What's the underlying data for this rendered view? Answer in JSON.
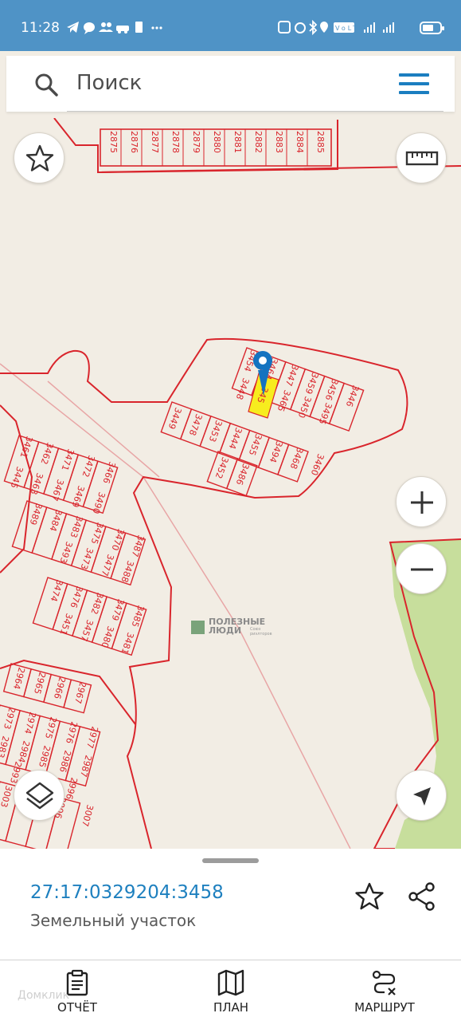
{
  "status_bar": {
    "time": "11:28",
    "left_icons": [
      "telegram-icon",
      "chat-icon",
      "people-icon",
      "car-icon",
      "sim-icon",
      "more-icon"
    ],
    "right_icons": [
      "nfc-icon",
      "alarm-icon",
      "bluetooth-icon",
      "location-icon",
      "volte-icon",
      "signal-icon",
      "wifi-signal-icon",
      "battery-icon"
    ],
    "network_label": "VoLTE"
  },
  "search": {
    "placeholder": "Поиск"
  },
  "map": {
    "parcels_top": [
      "2875",
      "2876",
      "2877",
      "2878",
      "2879",
      "2880",
      "2881",
      "2882",
      "2883",
      "2884",
      "2885"
    ],
    "parcels_cluster_north": [
      "3454",
      "3464",
      "3448",
      "3447",
      "3459",
      "3456",
      "3446",
      "3465",
      "3450",
      "3495",
      "3449",
      "3478",
      "3453",
      "3444",
      "3455",
      "3494",
      "3468",
      "3460",
      "3452",
      "3486"
    ],
    "selected_parcel": "345",
    "parcels_west_a": [
      "3461",
      "3445",
      "3462",
      "3463",
      "3471",
      "3467",
      "3472",
      "3469",
      "3466",
      "3490"
    ],
    "parcels_west_b": [
      "3489",
      "3484",
      "3483",
      "3493",
      "3475",
      "3473",
      "3470",
      "3477",
      "3487",
      "3488"
    ],
    "parcels_west_c": [
      "3474",
      "3476",
      "3451",
      "3482",
      "3457",
      "3479",
      "3480",
      "3485",
      "3481"
    ],
    "parcels_south_a": [
      "2964",
      "2965",
      "2966",
      "2967"
    ],
    "parcels_south_b": [
      "2973",
      "2983",
      "2974",
      "2984",
      "2975",
      "2985",
      "2976",
      "2986",
      "2977",
      "2987"
    ],
    "parcels_south_c": [
      "3003",
      "3005",
      "3006",
      "2996",
      "3007",
      "2993"
    ],
    "watermark_title": "ПОЛЕЗНЫЕ ЛЮДИ",
    "watermark_sub": "Союз риэлторов",
    "colors": {
      "parcel_border": "#d9252c",
      "selected_fill": "#f7ec1e",
      "green_zone": "#c7de9c",
      "pin": "#1473c0",
      "background": "#f2ede4"
    }
  },
  "panel": {
    "cadastral_number": "27:17:0329204:3458",
    "object_type": "Земельный участок"
  },
  "nav": {
    "report": "ОТЧЁТ",
    "plan": "ПЛАН",
    "route": "МАРШРУТ"
  },
  "watermark_brand": "Домклик"
}
